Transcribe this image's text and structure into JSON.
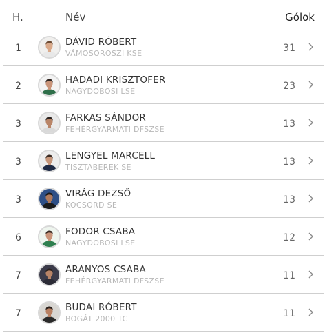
{
  "header": {
    "rank": "H.",
    "name": "Név",
    "goals": "Gólok"
  },
  "rows": [
    {
      "rank": "1",
      "name": "DÁVID RÓBERT",
      "club": "VÁMOSOROSZI KSE",
      "goals": "31",
      "skin": "#d9a98a",
      "hair": "#6b4a33",
      "shirt": "#e8e8e8",
      "bg": "#f0efed"
    },
    {
      "rank": "2",
      "name": "HADADI KRISZTOFER",
      "club": "NAGYDOBOSI LSE",
      "goals": "23",
      "skin": "#c99479",
      "hair": "#2e2420",
      "shirt": "#2f6f4a",
      "bg": "#f3f3f3"
    },
    {
      "rank": "3",
      "name": "FARKAS SÁNDOR",
      "club": "FEHÉRGYARMATI DFSZSE",
      "goals": "13",
      "skin": "#b98568",
      "hair": "#2a221f",
      "shirt": "#d9d9d9",
      "bg": "#e9e9e9"
    },
    {
      "rank": "3",
      "name": "LENGYEL MARCELL",
      "club": "TISZTABEREK SE",
      "goals": "13",
      "skin": "#c7967a",
      "hair": "#3a2a22",
      "shirt": "#1f2a44",
      "bg": "#ededed"
    },
    {
      "rank": "3",
      "name": "VIRÁG DEZSŐ",
      "club": "KOCSORD SE",
      "goals": "13",
      "skin": "#b07a5c",
      "hair": "#1d1a18",
      "shirt": "#1b1b1b",
      "bg": "#2e4f86"
    },
    {
      "rank": "6",
      "name": "FODOR CSABA",
      "club": "NAGYDOBOSI LSE",
      "goals": "12",
      "skin": "#c99479",
      "hair": "#3a2a22",
      "shirt": "#2f7f4f",
      "bg": "#eef5ee"
    },
    {
      "rank": "7",
      "name": "ARANYOS CSABA",
      "club": "FEHÉRGYARMATI DFSZSE",
      "goals": "11",
      "skin": "#b88467",
      "hair": "#2a2220",
      "shirt": "#2b2b36",
      "bg": "#3b3b4a"
    },
    {
      "rank": "7",
      "name": "BUDAI RÓBERT",
      "club": "BOGÁT 2000 TC",
      "goals": "11",
      "skin": "#b98062",
      "hair": "#2a201c",
      "shirt": "#2a2a2a",
      "bg": "#d8d6d2"
    }
  ]
}
